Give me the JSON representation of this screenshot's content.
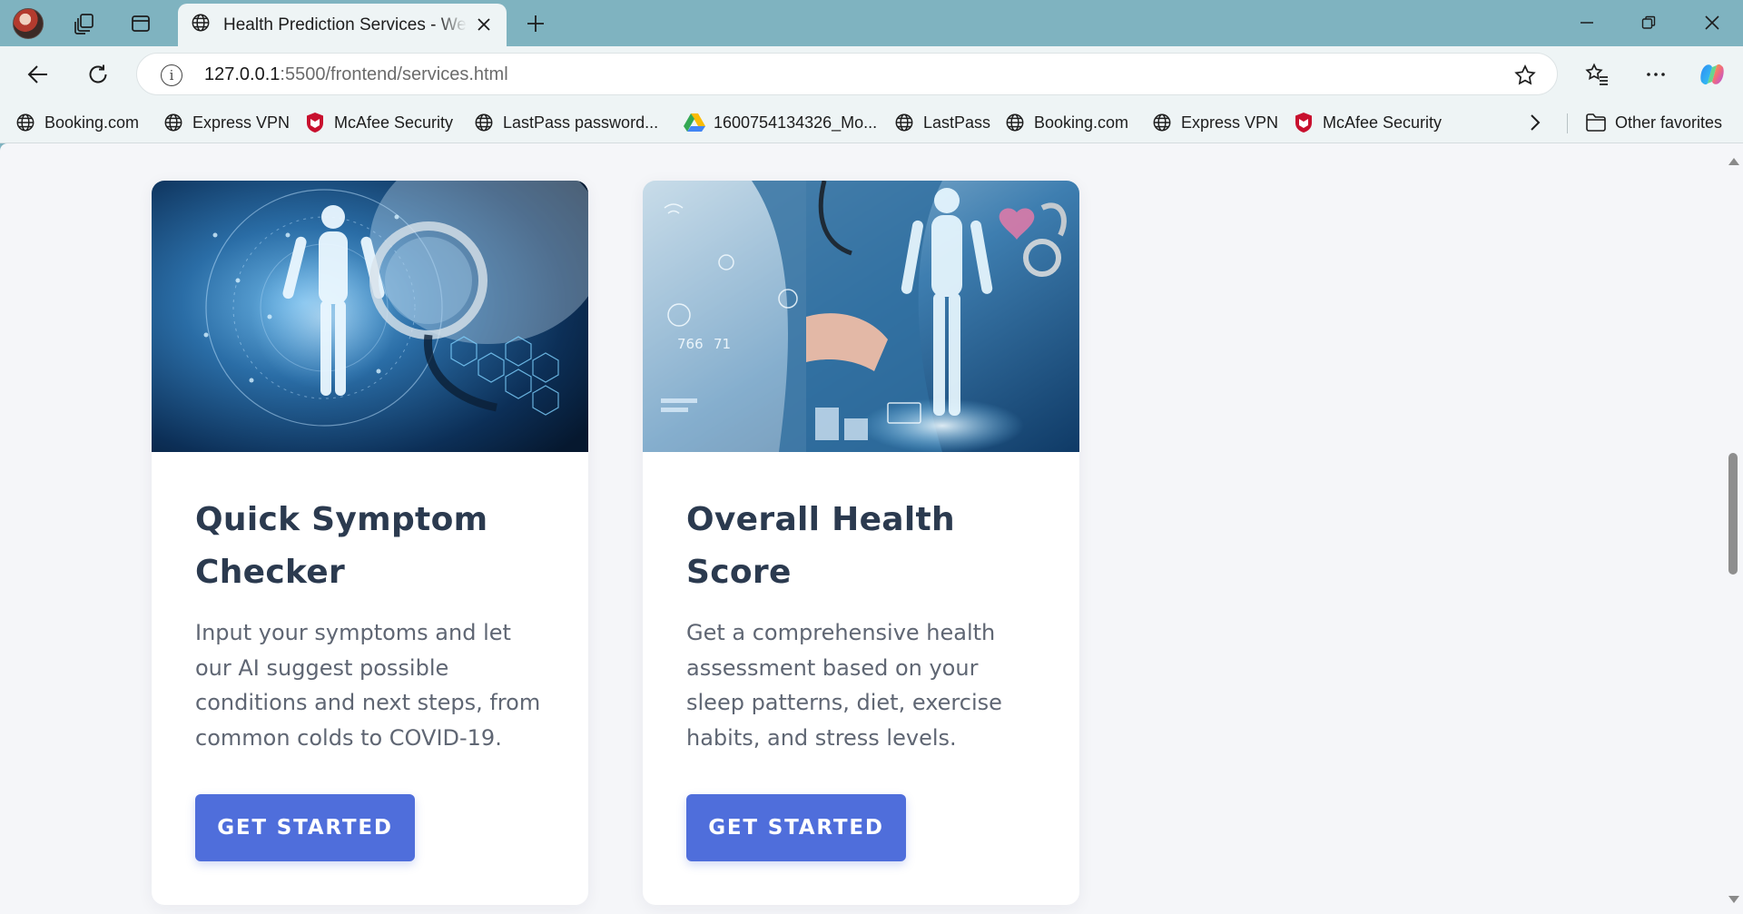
{
  "browser": {
    "tab": {
      "title": "Health Prediction Services - WellPredict"
    },
    "address_bar": {
      "host": "127.0.0.1",
      "path": ":5500/frontend/services.html"
    },
    "favorites": [
      {
        "label": "Booking.com",
        "icon": "globe-icon"
      },
      {
        "label": "Express VPN",
        "icon": "globe-icon"
      },
      {
        "label": "McAfee Security",
        "icon": "mcafee-shield-icon"
      },
      {
        "label": "LastPass password...",
        "icon": "globe-icon"
      },
      {
        "label": "1600754134326_Mo...",
        "icon": "google-drive-icon"
      },
      {
        "label": "LastPass",
        "icon": "globe-icon"
      },
      {
        "label": "Booking.com",
        "icon": "globe-icon"
      },
      {
        "label": "Express VPN",
        "icon": "globe-icon"
      },
      {
        "label": "McAfee Security",
        "icon": "mcafee-shield-icon"
      }
    ],
    "other_favorites": "Other favorites"
  },
  "cards": [
    {
      "title": "Quick Symptom Checker",
      "text": "Input your symptoms and let our AI suggest possible conditions and next steps, from common colds to COVID-19.",
      "button": "GET STARTED"
    },
    {
      "title": "Overall Health Score",
      "text": "Get a comprehensive health assessment based on your sleep patterns, diet, exercise habits, and stress levels.",
      "button": "GET STARTED"
    }
  ],
  "colors": {
    "titlebar": "#7fb3c0",
    "toolbar": "#eef4f5",
    "page_bg": "#f5f6f9",
    "heading": "#2b3a4f",
    "body_text": "#5f6673",
    "button": "#4f6edb"
  }
}
